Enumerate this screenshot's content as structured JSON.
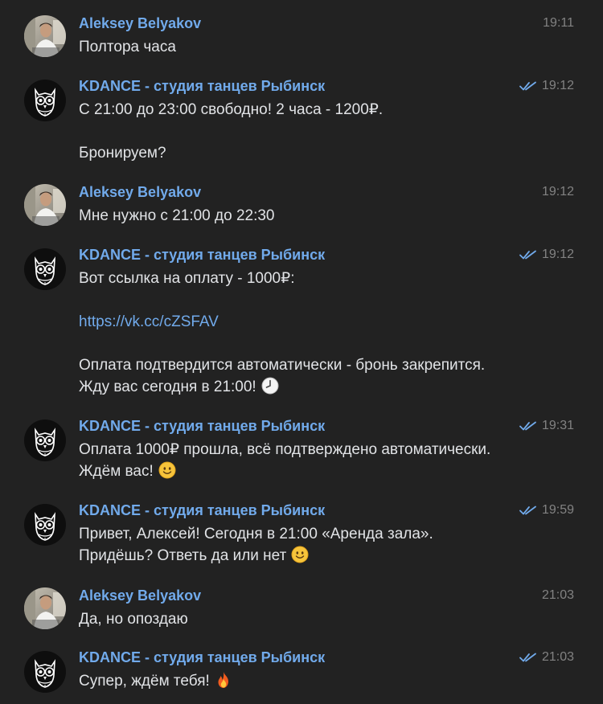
{
  "feed": {
    "sender_a": "Aleksey Belyakov",
    "sender_b": "KDANCE - студия танцев Рыбинск",
    "messages": [
      {
        "sender": "Aleksey Belyakov",
        "time": "19:11",
        "lines": [
          "Полтора часа"
        ]
      },
      {
        "sender": "KDANCE - студия танцев Рыбинск",
        "time": "19:12",
        "read": true,
        "lines": [
          "С 21:00 до 23:00 свободно! 2 часа - 1200₽.",
          "",
          "Бронируем?"
        ]
      },
      {
        "sender": "Aleksey Belyakov",
        "time": "19:12",
        "lines": [
          "Мне нужно с 21:00 до 22:30"
        ]
      },
      {
        "sender": "KDANCE - студия танцев Рыбинск",
        "time": "19:12",
        "read": true,
        "lines": [
          "Вот ссылка на оплату - 1000₽:",
          "",
          "https://vk.cc/cZSFAV",
          "",
          "Оплата подтвердится автоматически - бронь закрепится.",
          "Жду вас сегодня в 21:00!"
        ],
        "link": "https://vk.cc/cZSFAV",
        "emoji": "clock-emoji"
      },
      {
        "sender": "KDANCE - студия танцев Рыбинск",
        "time": "19:31",
        "read": true,
        "lines": [
          "Оплата 1000₽ прошла, всё подтверждено автоматически.",
          "Ждём вас!"
        ],
        "emoji": "smile-emoji"
      },
      {
        "sender": "KDANCE - студия танцев Рыбинск",
        "time": "19:59",
        "read": true,
        "lines": [
          "Привет, Алексей! Сегодня в 21:00 «Аренда зала».",
          "Придёшь? Ответь да или нет"
        ],
        "emoji": "smile-emoji"
      },
      {
        "sender": "Aleksey Belyakov",
        "time": "21:03",
        "lines": [
          "Да, но опоздаю"
        ]
      },
      {
        "sender": "KDANCE - студия танцев Рыбинск",
        "time": "21:03",
        "read": true,
        "lines": [
          "Супер, ждём тебя!"
        ],
        "emoji": "fire-emoji"
      }
    ]
  },
  "colors": {
    "background": "#222222",
    "sender": "#71aaeb",
    "text": "#e1e3e6",
    "time": "#828282",
    "link": "#71aaeb",
    "read_ticks": "#71aaeb"
  },
  "icons": {
    "read_status": "double-check-icon",
    "user_avatar": "user-photo-avatar",
    "group_avatar": "owl-logo-avatar"
  }
}
